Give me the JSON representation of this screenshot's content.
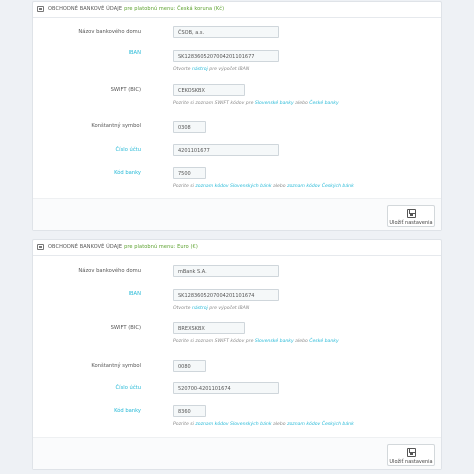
{
  "panels": [
    {
      "title": "OBCHODNÉ BANKOVÉ ÚDAJE",
      "subtitle": "pre platobnú menu: Česká koruna (Kč)",
      "bank_name_label": "Názov bankového domu",
      "bank_name_value": "ČSOB, a.s.",
      "iban_label": "IBAN",
      "iban_value": "SK1283605207004201101677",
      "iban_help_prefix": "Otvorte ",
      "iban_help_link": "nástroj",
      "iban_help_suffix": " pre výpočet IBAN",
      "swift_label": "SWIFT (BIC)",
      "swift_value": "CEKOSKBX",
      "swift_help_prefix": "Pozrite si zoznam SWIFT kódov pre ",
      "swift_help_link1": "Slovenské banky",
      "swift_help_mid": " alebo ",
      "swift_help_link2": "České banky",
      "const_symbol_label": "Konštantný symbol",
      "const_symbol_value": "0308",
      "account_label": "Číslo účtu",
      "account_value": "4201101677",
      "bank_code_label": "Kód banky",
      "bank_code_value": "7500",
      "bank_code_help_prefix": "Pozrite si ",
      "bank_code_help_link1": "zoznam kódov Slovenských bánk",
      "bank_code_help_mid": " alebo ",
      "bank_code_help_link2": "zoznam kódov Českých bánk",
      "save_label": "Uložiť nastavenia"
    },
    {
      "title": "OBCHODNÉ BANKOVÉ ÚDAJE",
      "subtitle": "pre platobnú menu: Euro (€)",
      "bank_name_label": "Názov bankového domu",
      "bank_name_value": "mBank S.A.",
      "iban_label": "IBAN",
      "iban_value": "SK1283605207004201101674",
      "iban_help_prefix": "Otvorte ",
      "iban_help_link": "nástroj",
      "iban_help_suffix": " pre výpočet IBAN",
      "swift_label": "SWIFT (BIC)",
      "swift_value": "BREXSKBX",
      "swift_help_prefix": "Pozrite si zoznam SWIFT kódov pre ",
      "swift_help_link1": "Slovenské banky",
      "swift_help_mid": " alebo ",
      "swift_help_link2": "České banky",
      "const_symbol_label": "Konštantný symbol",
      "const_symbol_value": "0080",
      "account_label": "Číslo účtu",
      "account_value": "520700-4201101674",
      "bank_code_label": "Kód banky",
      "bank_code_value": "8360",
      "bank_code_help_prefix": "Pozrite si ",
      "bank_code_help_link1": "zoznam kódov Slovenských bánk",
      "bank_code_help_mid": " alebo ",
      "bank_code_help_link2": "zoznam kódov Českých bánk",
      "save_label": "Uložiť nastavenia"
    }
  ]
}
